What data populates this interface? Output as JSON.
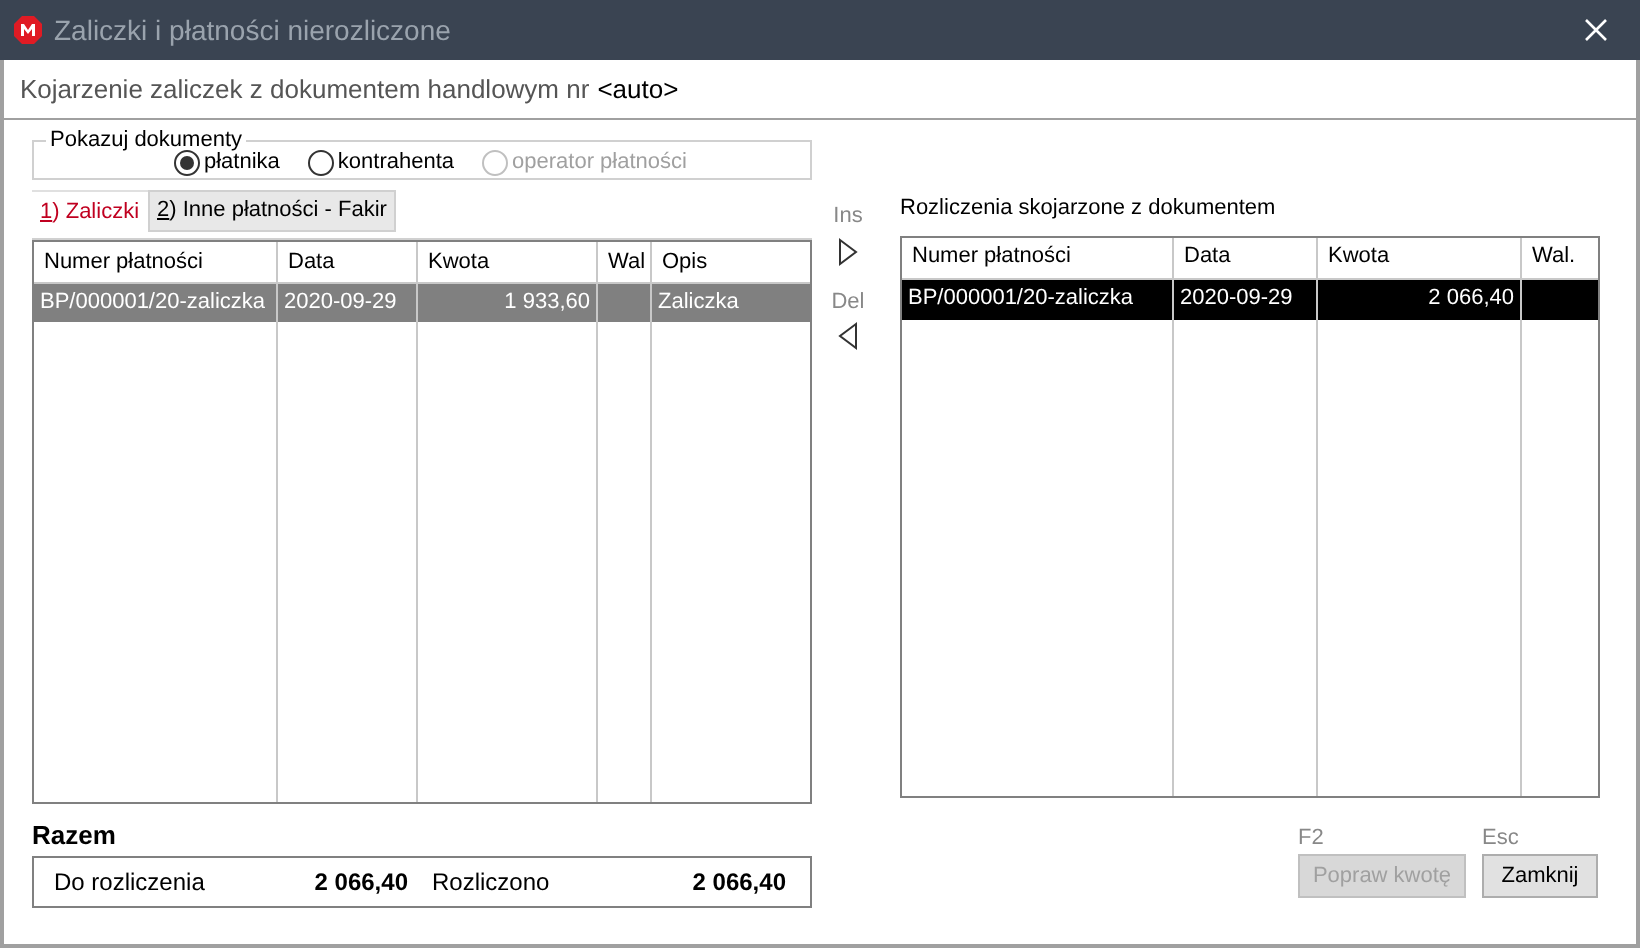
{
  "window": {
    "title": "Zaliczki i płatności nierozliczone"
  },
  "header": {
    "text": "Kojarzenie zaliczek z dokumentem handlowym nr",
    "number": "<auto>"
  },
  "filter": {
    "legend": "Pokazuj dokumenty",
    "options": [
      {
        "label": "płatnika",
        "selected": true,
        "disabled": false
      },
      {
        "label": "kontrahenta",
        "selected": false,
        "disabled": false
      },
      {
        "label": "operator płatności",
        "selected": false,
        "disabled": true
      }
    ]
  },
  "tabs": [
    {
      "label": "**1**) Zaliczki",
      "selected": true
    },
    {
      "label": "**2**) Inne płatności - Fakir",
      "selected": false
    }
  ],
  "left_table": {
    "columns": [
      "Numer płatności",
      "Data",
      "Kwota",
      "Wal",
      "Opis"
    ],
    "rows": [
      {
        "cells": [
          "BP/000001/20-zaliczka",
          "2020-09-29",
          "1 933,60",
          "",
          "Zaliczka"
        ],
        "selected": true
      }
    ]
  },
  "transfer": [
    {
      "key": "Ins",
      "kind": "add"
    },
    {
      "key": "Del",
      "kind": "remove"
    }
  ],
  "right_table": {
    "title": "Rozliczenia skojarzone z dokumentem",
    "columns": [
      "Numer płatności",
      "Data",
      "Kwota",
      "Wal."
    ],
    "rows": [
      {
        "cells": [
          "BP/000001/20-zaliczka",
          "2020-09-29",
          "2 066,40",
          ""
        ],
        "selected": true
      }
    ]
  },
  "summary": {
    "title": "Razem",
    "items": [
      {
        "label": "Do rozliczenia",
        "value": "2 066,40"
      },
      {
        "label": "Rozliczono",
        "value": "2 066,40"
      }
    ]
  },
  "buttons": [
    {
      "shortcut": "F2",
      "label": "Popraw kwotę",
      "disabled": true
    },
    {
      "shortcut": "Esc",
      "label": "Zamknij",
      "disabled": false
    }
  ]
}
